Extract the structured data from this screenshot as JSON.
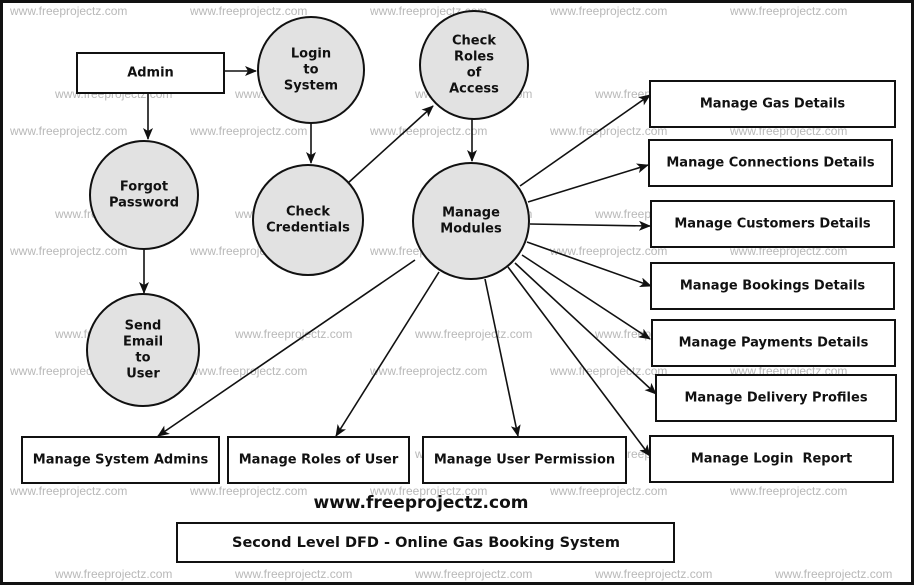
{
  "watermark": "www.freeprojectz.com",
  "site_label": "www.freeprojectz.com",
  "diagram_title": "Second Level DFD - Online Gas Booking System",
  "nodes": {
    "admin": {
      "type": "entity",
      "lines": [
        "Admin"
      ]
    },
    "login": {
      "type": "process",
      "lines": [
        "Login",
        "to",
        "System"
      ]
    },
    "check_roles": {
      "type": "process",
      "lines": [
        "Check",
        "Roles",
        "of",
        "Access"
      ]
    },
    "forgot": {
      "type": "process",
      "lines": [
        "Forgot",
        "Password"
      ]
    },
    "check_cred": {
      "type": "process",
      "lines": [
        "Check",
        "Credentials"
      ]
    },
    "manage_modules": {
      "type": "process",
      "lines": [
        "Manage",
        "Modules"
      ]
    },
    "send_email": {
      "type": "process",
      "lines": [
        "Send",
        "Email",
        "to",
        "User"
      ]
    },
    "gas": {
      "type": "entity",
      "lines": [
        "Manage Gas Details"
      ]
    },
    "connections": {
      "type": "entity",
      "lines": [
        "Manage Connections Details"
      ]
    },
    "customers": {
      "type": "entity",
      "lines": [
        "Manage Customers Details"
      ]
    },
    "bookings": {
      "type": "entity",
      "lines": [
        "Manage Bookings Details"
      ]
    },
    "payments": {
      "type": "entity",
      "lines": [
        "Manage Payments Details"
      ]
    },
    "delivery": {
      "type": "entity",
      "lines": [
        "Manage Delivery Profiles"
      ]
    },
    "login_report": {
      "type": "entity",
      "lines": [
        "Manage Login  Report"
      ]
    },
    "sys_admins": {
      "type": "entity",
      "lines": [
        "Manage System Admins"
      ]
    },
    "roles_user": {
      "type": "entity",
      "lines": [
        "Manage Roles of User"
      ]
    },
    "user_perm": {
      "type": "entity",
      "lines": [
        "Manage User Permission"
      ]
    }
  },
  "edges": [
    [
      "admin",
      "login"
    ],
    [
      "admin",
      "forgot"
    ],
    [
      "login",
      "check_cred"
    ],
    [
      "check_cred",
      "check_roles"
    ],
    [
      "check_roles",
      "manage_modules"
    ],
    [
      "forgot",
      "send_email"
    ],
    [
      "manage_modules",
      "gas"
    ],
    [
      "manage_modules",
      "connections"
    ],
    [
      "manage_modules",
      "customers"
    ],
    [
      "manage_modules",
      "bookings"
    ],
    [
      "manage_modules",
      "payments"
    ],
    [
      "manage_modules",
      "delivery"
    ],
    [
      "manage_modules",
      "login_report"
    ],
    [
      "manage_modules",
      "sys_admins"
    ],
    [
      "manage_modules",
      "roles_user"
    ],
    [
      "manage_modules",
      "user_perm"
    ]
  ]
}
